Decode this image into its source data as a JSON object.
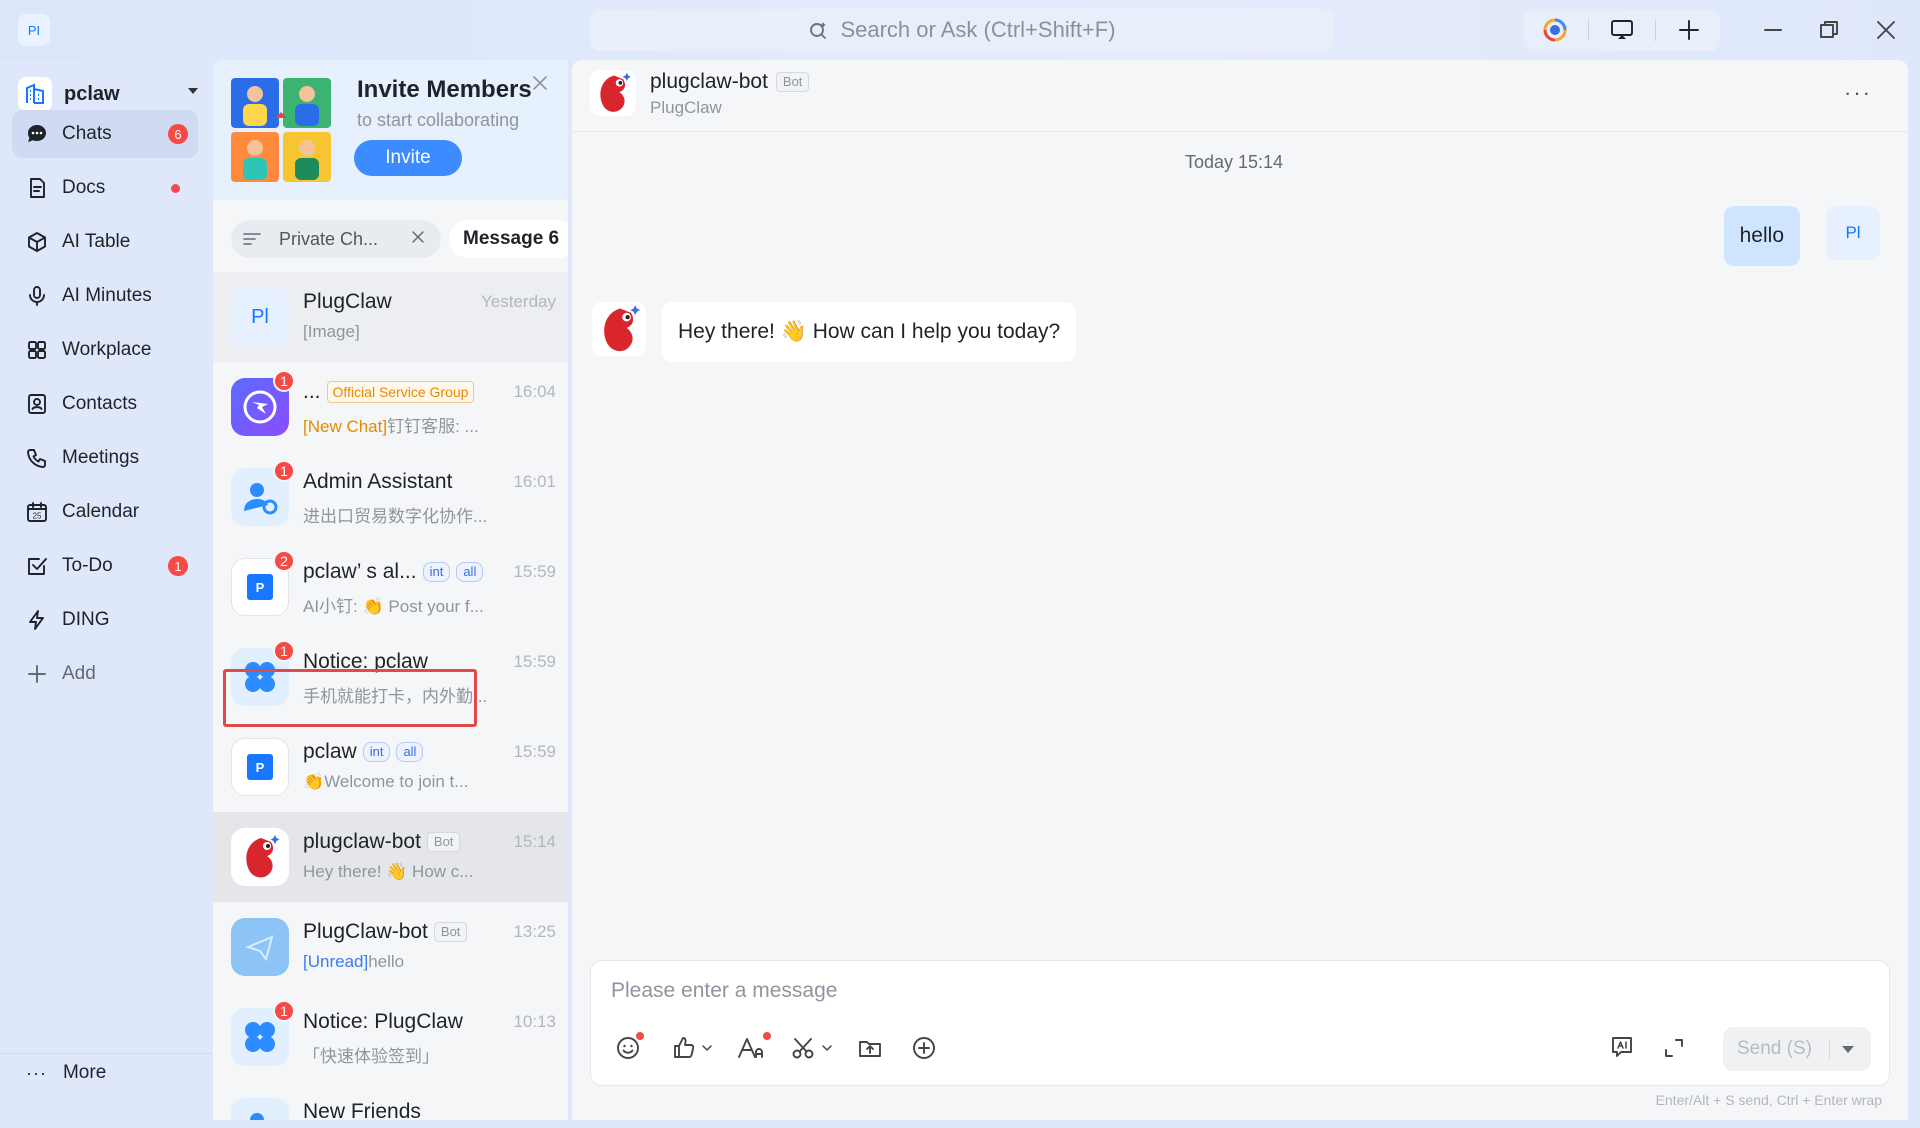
{
  "app": {
    "badge": "PI"
  },
  "search": {
    "placeholder": "Search or Ask  (Ctrl+Shift+F)"
  },
  "org": {
    "name": "pclaw"
  },
  "nav": {
    "items": [
      {
        "label": "Chats",
        "badge": "6"
      },
      {
        "label": "Docs"
      },
      {
        "label": "AI Table"
      },
      {
        "label": "AI Minutes"
      },
      {
        "label": "Workplace"
      },
      {
        "label": "Contacts"
      },
      {
        "label": "Meetings"
      },
      {
        "label": "Calendar"
      },
      {
        "label": "To-Do",
        "badge": "1"
      },
      {
        "label": "DING"
      },
      {
        "label": "Add"
      }
    ],
    "more": "More"
  },
  "invite": {
    "title": "Invite Members",
    "subtitle": "to start collaborating",
    "button": "Invite"
  },
  "filters": {
    "private": "Private Ch...",
    "message": "Message 6"
  },
  "chats": [
    {
      "avatar": "Pl",
      "name": "PlugClaw",
      "time": "Yesterday",
      "preview": "[Image]"
    },
    {
      "name": "...",
      "tag": "Official Service Group",
      "time": "16:04",
      "badge": "1",
      "preview_prefix": "[New Chat]",
      "preview": "钉钉客服: ..."
    },
    {
      "name": "Admin Assistant",
      "time": "16:01",
      "badge": "1",
      "preview": "进出口贸易数字化协作..."
    },
    {
      "avatar": "P",
      "name": "pclaw’ s al...",
      "tags": [
        "int",
        "all"
      ],
      "time": "15:59",
      "badge": "2",
      "preview": "AI小钉: 👏 Post your f..."
    },
    {
      "name": "Notice: pclaw",
      "time": "15:59",
      "badge": "1",
      "preview": "手机就能打卡，内外勤..."
    },
    {
      "avatar": "P",
      "name": "pclaw",
      "tags": [
        "int",
        "all"
      ],
      "time": "15:59",
      "preview": "👏Welcome to join t..."
    },
    {
      "name": "plugclaw-bot",
      "tag": "Bot",
      "time": "15:14",
      "preview": "Hey there! 👋 How c..."
    },
    {
      "name": "PlugClaw-bot",
      "tag": "Bot",
      "time": "13:25",
      "preview_prefix": "[Unread]",
      "preview": "hello"
    },
    {
      "name": "Notice: PlugClaw",
      "time": "10:13",
      "badge": "1",
      "preview": "「快速体验签到」"
    },
    {
      "name": "New Friends"
    }
  ],
  "conversation": {
    "title": "plugclaw-bot",
    "tag": "Bot",
    "subtitle": "PlugClaw",
    "timestamp": "Today 15:14",
    "messages": [
      {
        "from": "me",
        "avatar": "Pl",
        "text": "hello"
      },
      {
        "from": "bot",
        "text": "Hey there! 👋 How can I help you today?"
      }
    ]
  },
  "composer": {
    "placeholder": "Please enter a message",
    "send": "Send (S)",
    "hint": "Enter/Alt + S send, Ctrl + Enter wrap"
  },
  "colors": {
    "accent": "#3c8cff",
    "badge": "#f54a45",
    "outgoing_bubble": "#cfe5fd",
    "highlight": "#e04a4a"
  }
}
